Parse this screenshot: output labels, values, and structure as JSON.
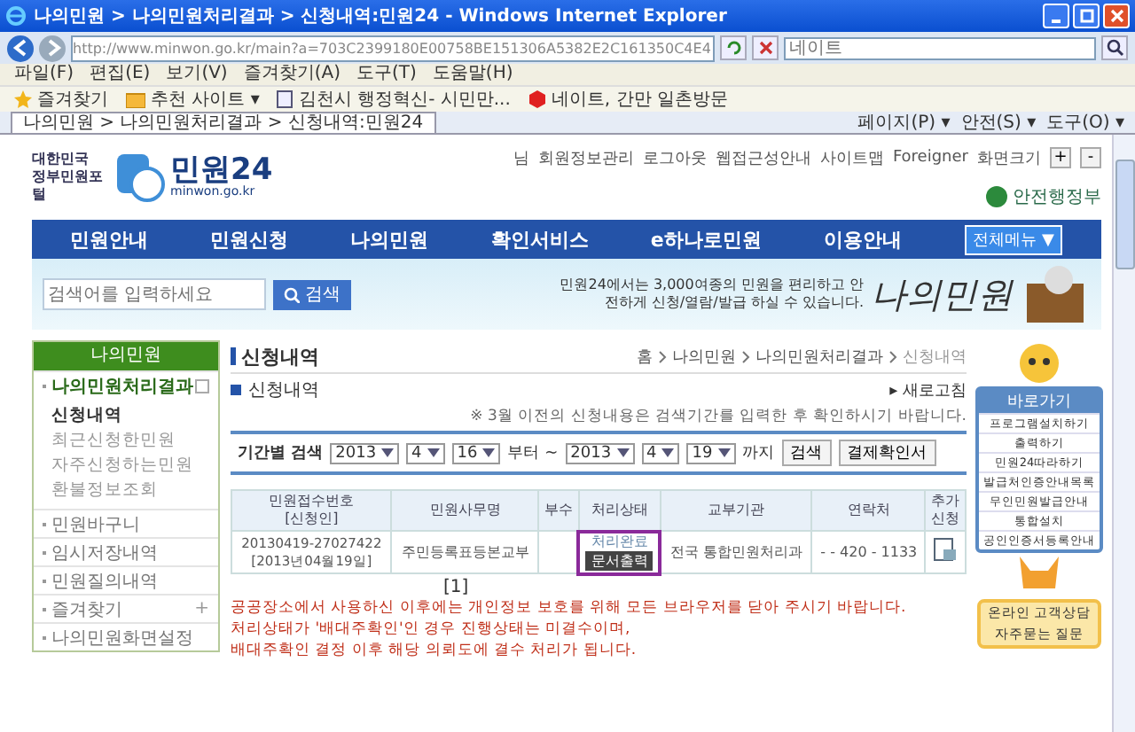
{
  "window": {
    "title": "나의민원 > 나의민원처리결과 > 신청내역:민원24 - Windows Internet Explorer"
  },
  "address_bar": {
    "url": "http://www.minwon.go.kr/main?a=703C2399180E00758BE151306A5382E2C161350C4E4",
    "search_placeholder": "네이트"
  },
  "menu_bar": [
    "파일(F)",
    "편집(E)",
    "보기(V)",
    "즐겨찾기(A)",
    "도구(T)",
    "도움말(H)"
  ],
  "favorites_bar": [
    {
      "label": "즐겨찾기",
      "kind": "star"
    },
    {
      "label": "추천 사이트 ▾",
      "kind": "folder"
    },
    {
      "label": "김천시 행정혁신- 시민만...",
      "kind": "page"
    },
    {
      "label": "네이트, 간만 일촌방문",
      "kind": "nate"
    }
  ],
  "tab": {
    "label": "나의민원 > 나의민원처리결과 > 신청내역:민원24"
  },
  "command_bar": [
    "페이지(P) ▾",
    "안전(S) ▾",
    "도구(O) ▾"
  ],
  "site": {
    "portal": "대한민국 정부민원포털",
    "logo": "민원24",
    "logo_sub": "minwon.go.kr",
    "ministry": "안전행정부",
    "user": "님",
    "top_links": [
      "회원정보관리",
      "로그아웃",
      "웹접근성안내",
      "사이트맵",
      "Foreigner",
      "화면크기"
    ],
    "zoom_buttons": [
      "+",
      "-"
    ]
  },
  "nav": {
    "items": [
      "민원안내",
      "민원신청",
      "나의민원",
      "확인서비스",
      "e하나로민원",
      "이용안내"
    ],
    "all_menu": "전체메뉴 ▼"
  },
  "banner": {
    "search_placeholder": "검색어를 입력하세요",
    "search_button": "검색",
    "text": "민원24에서는 3,000여종의 민원을 편리하고 안전하게 신청/열람/발급 하실 수 있습니다.",
    "title": "나의민원"
  },
  "sidebar": {
    "title": "나의민원",
    "items": [
      {
        "label": "나의민원처리결과",
        "expanded": true,
        "children": [
          {
            "label": "신청내역",
            "selected": true
          },
          {
            "label": "최근신청한민원",
            "selected": false
          },
          {
            "label": "자주신청하는민원",
            "selected": false
          },
          {
            "label": "환불정보조회",
            "selected": false
          }
        ]
      },
      {
        "label": "민원바구니",
        "expanded": false
      },
      {
        "label": "임시저장내역",
        "expanded": false
      },
      {
        "label": "민원질의내역",
        "expanded": false
      },
      {
        "label": "즐겨찾기",
        "expanded": false,
        "toggle": "+"
      },
      {
        "label": "나의민원화면설정",
        "expanded": false
      }
    ]
  },
  "main": {
    "heading": "신청내역",
    "breadcrumb": [
      "홈",
      "나의민원",
      "나의민원처리결과",
      "신청내역"
    ],
    "subheading": "신청내역",
    "refresh": "▸ 새로고침",
    "notice": "※ 3월 이전의 신청내용은 검색기간를 입력한 후 확인하시기 바랍니다.",
    "filter": {
      "label": "기간별 검색",
      "from": [
        "2013",
        "4",
        "16"
      ],
      "from_word": "부터 ~",
      "to": [
        "2013",
        "4",
        "19"
      ],
      "to_word": "까지",
      "buttons": [
        "검색",
        "결제확인서"
      ]
    },
    "table": {
      "columns": [
        "민원접수번호\n[신청인]",
        "민원사무명",
        "부수",
        "처리상태",
        "교부기관",
        "연락처",
        "추가\n신청"
      ],
      "rows": [
        {
          "number": "20130419-27027422",
          "date": "[2013년04월19일]",
          "service": "주민등록표등본교부",
          "status": "처리완료",
          "status_button": "문서출력",
          "highlighted": true,
          "office": "전국 통합민원처리과",
          "contact": "- - 420 - 1133"
        }
      ]
    },
    "pagination": "[1]",
    "notes": [
      "공공장소에서 사용하신 이후에는 개인정보 보호를 위해 모든 브라우저를 닫아 주시기 바랍니다.",
      "처리상태가 '배대주확인'인 경우 진행상태는 미결수이며,",
      "배대주확인 결정 이후 해당 의뢰도에 결수 처리가 됩니다."
    ]
  },
  "quick": {
    "title": "바로가기",
    "links": [
      "프로그램설치하기",
      "출력하기",
      "민원24따라하기",
      "발급처인증안내목록",
      "무인민원발급안내",
      "통합설치",
      "공인인증서등록안내"
    ],
    "help": [
      "온라인 고객상담",
      "자주묻는 질문"
    ]
  }
}
